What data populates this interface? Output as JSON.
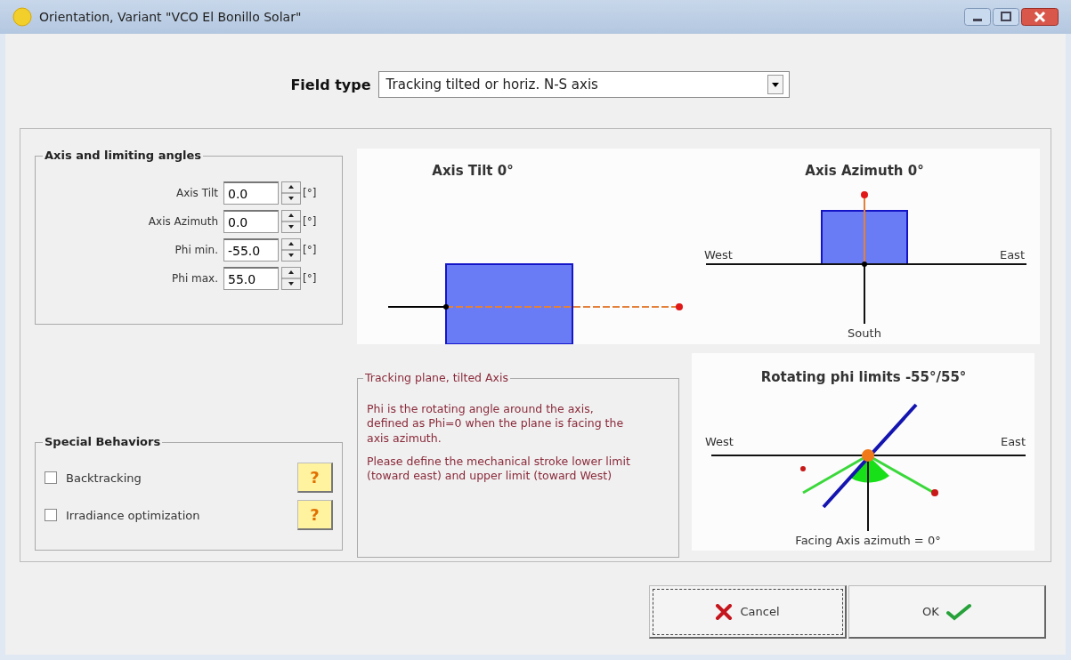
{
  "window": {
    "title": "Orientation, Variant \"VCO El Bonillo Solar\""
  },
  "field_type": {
    "label": "Field type",
    "value": "Tracking tilted or horiz. N-S axis"
  },
  "axis_group": {
    "title": "Axis and limiting angles",
    "fields": [
      {
        "label": "Axis Tilt",
        "value": "0.0",
        "unit": "[°]"
      },
      {
        "label": "Axis Azimuth",
        "value": "0.0",
        "unit": "[°]"
      },
      {
        "label": "Phi min.",
        "value": "-55.0",
        "unit": "[°]"
      },
      {
        "label": "Phi max.",
        "value": "55.0",
        "unit": "[°]"
      }
    ]
  },
  "tilt_diagram": {
    "title": "Axis Tilt 0°"
  },
  "azimuth_diagram": {
    "title": "Axis Azimuth 0°",
    "west": "West",
    "east": "East",
    "south": "South"
  },
  "special_group": {
    "title": "Special Behaviors",
    "options": [
      {
        "label": "Backtracking",
        "checked": false,
        "help": "?"
      },
      {
        "label": "Irradiance optimization",
        "checked": false,
        "help": "?"
      }
    ]
  },
  "info_box": {
    "title": "Tracking plane, tilted Axis",
    "paragraphs": [
      "Phi is the rotating angle around the axis, defined as Phi=0 when the plane is facing the axis azimuth.",
      "Please define the mechanical stroke lower limit (toward east) and upper limit (toward West)"
    ]
  },
  "phi_diagram": {
    "title": "Rotating phi limits -55°/55°",
    "west": "West",
    "east": "East",
    "caption": "Facing Axis azimuth = 0°"
  },
  "buttons": [
    {
      "kind": "cancel",
      "label": "Cancel",
      "focused": true
    },
    {
      "kind": "ok",
      "label": "OK",
      "focused": false
    }
  ]
}
